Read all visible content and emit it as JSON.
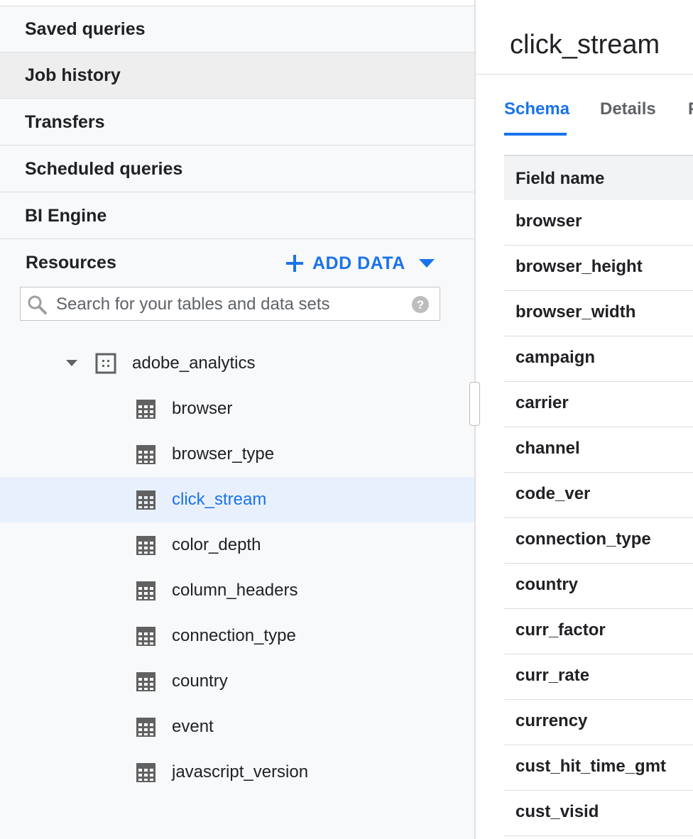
{
  "sidebar": {
    "nav": [
      {
        "label": "Saved queries",
        "active": false
      },
      {
        "label": "Job history",
        "active": true
      },
      {
        "label": "Transfers",
        "active": false
      },
      {
        "label": "Scheduled queries",
        "active": false
      },
      {
        "label": "BI Engine",
        "active": false
      }
    ],
    "resources": {
      "title": "Resources",
      "add_data_label": "ADD DATA",
      "add_icon": "plus-icon",
      "add_menu_icon": "caret-down-icon"
    },
    "search": {
      "placeholder": "Search for your tables and data sets",
      "value": "",
      "icon": "search-icon",
      "help_icon": "help-icon"
    },
    "tree": {
      "dataset": {
        "label": "adobe_analytics",
        "icon": "dataset-icon",
        "expanded": true
      },
      "tables": [
        {
          "label": "browser",
          "selected": false
        },
        {
          "label": "browser_type",
          "selected": false
        },
        {
          "label": "click_stream",
          "selected": true
        },
        {
          "label": "color_depth",
          "selected": false
        },
        {
          "label": "column_headers",
          "selected": false
        },
        {
          "label": "connection_type",
          "selected": false
        },
        {
          "label": "country",
          "selected": false
        },
        {
          "label": "event",
          "selected": false
        },
        {
          "label": "javascript_version",
          "selected": false
        }
      ],
      "table_icon": "table-icon"
    }
  },
  "main": {
    "title": "click_stream",
    "tabs": [
      {
        "label": "Schema",
        "active": true
      },
      {
        "label": "Details",
        "active": false
      },
      {
        "label": "P",
        "active": false
      }
    ],
    "schema": {
      "header": "Field name",
      "fields": [
        "browser",
        "browser_height",
        "browser_width",
        "campaign",
        "carrier",
        "channel",
        "code_ver",
        "connection_type",
        "country",
        "curr_factor",
        "curr_rate",
        "currency",
        "cust_hit_time_gmt",
        "cust_visid"
      ]
    }
  },
  "colors": {
    "accent": "#1a73e8",
    "sidebar_bg": "#f8f9fa",
    "active_nav_bg": "#eeeeee",
    "selected_row_bg": "#e8f0fe",
    "icon_gray": "#616161"
  }
}
